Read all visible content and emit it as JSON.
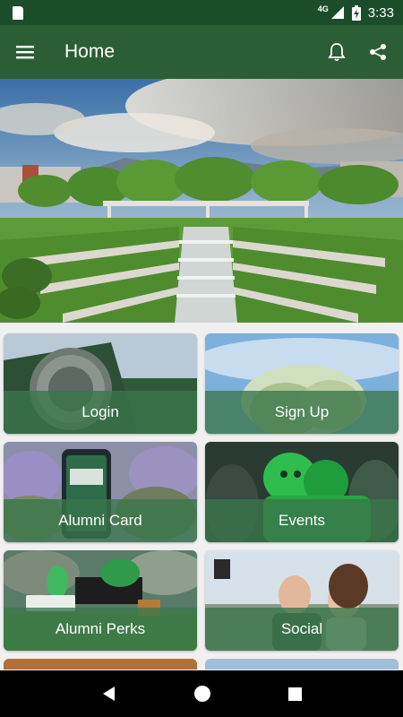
{
  "status_bar": {
    "time": "3:33",
    "network": "4G"
  },
  "app_bar": {
    "title": "Home",
    "icons": [
      "menu-icon",
      "bell-icon",
      "share-icon"
    ]
  },
  "tiles": [
    {
      "label": "Login"
    },
    {
      "label": "Sign Up"
    },
    {
      "label": "Alumni Card"
    },
    {
      "label": "Events"
    },
    {
      "label": "Alumni Perks"
    },
    {
      "label": "Social"
    }
  ],
  "colors": {
    "status_bar": "#1c4d2b",
    "app_bar": "#2b5e34",
    "tile_overlay": "#3a764a"
  },
  "navigation": {
    "icons": [
      "back-icon",
      "home-icon",
      "recents-icon"
    ]
  }
}
